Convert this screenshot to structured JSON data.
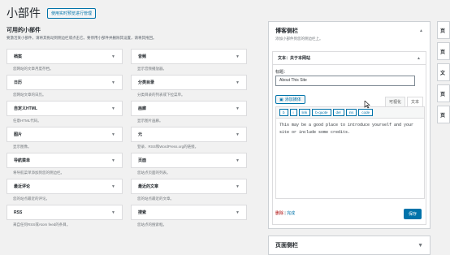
{
  "header": {
    "title": "小部件",
    "manage_label": "使用实时预览进行管理"
  },
  "available": {
    "title": "可用的小部件",
    "desc": "要激活某小部件，请将其拖动到侧边栏或点击它。要停用小部件并删除其设置，请将其拖回。",
    "widgets": [
      {
        "name": "档案",
        "desc": "您网站的文章月度存档。"
      },
      {
        "name": "日历",
        "desc": "您网站文章的日历。"
      },
      {
        "name": "自定义HTML",
        "desc": "任意HTML代码。"
      },
      {
        "name": "图片",
        "desc": "显示图像。"
      },
      {
        "name": "导航菜单",
        "desc": "将导航菜单添加到您的侧边栏。"
      },
      {
        "name": "最近评论",
        "desc": "您的站点最近的评论。"
      },
      {
        "name": "RSS",
        "desc": "来自任何RSS或Atom feed的条目。"
      },
      {
        "name": "音频",
        "desc": "显示音频播放器。"
      },
      {
        "name": "分类目录",
        "desc": "分类目录的列表或下拉菜单。"
      },
      {
        "name": "画廊",
        "desc": "显示图片画廊。"
      },
      {
        "name": "元",
        "desc": "登录、RSS和WordPress.org的链接。"
      },
      {
        "name": "页面",
        "desc": "您站点页面的列表。"
      },
      {
        "name": "最近的文章",
        "desc": "您的站点最近的文章。"
      },
      {
        "name": "搜索",
        "desc": "您站点的搜索框。"
      }
    ]
  },
  "sidebar": {
    "title": "博客侧栏",
    "desc": "添加小部件到您的侧边栏上。",
    "widget_head": "文本：关于本网站",
    "title_label": "标题：",
    "title_value": "About This Site",
    "add_media": "添加媒体",
    "tabs": [
      "可视化",
      "文本"
    ],
    "quicktags": [
      "b",
      "i",
      "link",
      "b-quote",
      "del",
      "ins",
      "img",
      "ul",
      "ol",
      "li",
      "code",
      "close tags"
    ],
    "content": "This may be a good place to introduce yourself and your site or include some credits.",
    "delete_label": "删除",
    "separator": " | ",
    "done_label": "完成",
    "save_label": "保存"
  },
  "footer_sidebar": {
    "title": "页面侧栏"
  },
  "right_boxes": [
    "页",
    "页",
    "文",
    "页",
    "页"
  ]
}
